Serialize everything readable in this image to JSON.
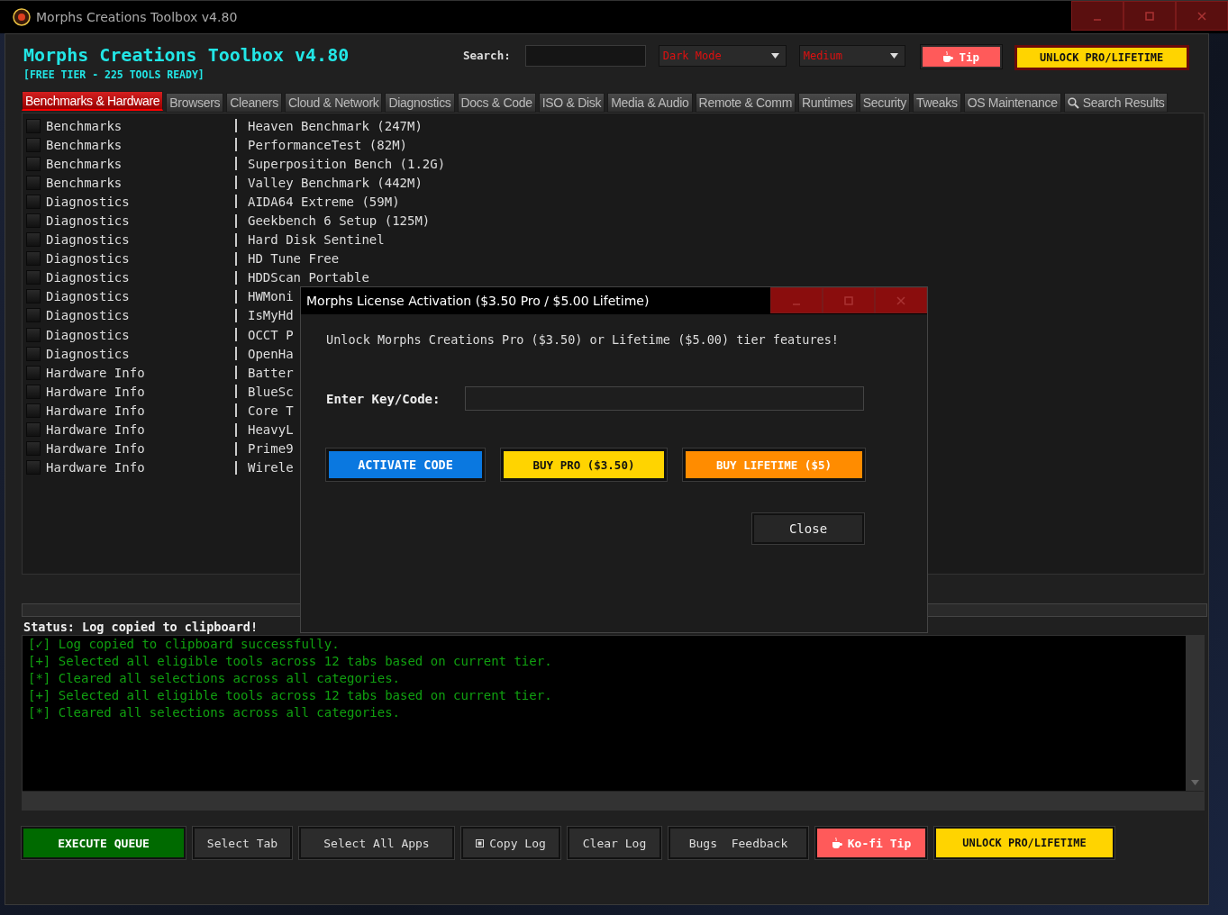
{
  "window": {
    "title": "Morphs Creations Toolbox v4.80"
  },
  "header": {
    "title": "Morphs Creations Toolbox v4.80",
    "subtitle": "[FREE TIER - 225 TOOLS READY]",
    "search_label": "Search:",
    "theme_select": "Dark Mode",
    "size_select": "Medium",
    "tip_button": "Tip",
    "unlock_button": "UNLOCK PRO/LIFETIME"
  },
  "tabs": [
    {
      "label": "Benchmarks & Hardware",
      "selected": true,
      "kind": "category"
    },
    {
      "label": "Browsers",
      "selected": false,
      "kind": "category"
    },
    {
      "label": "Cleaners",
      "selected": false,
      "kind": "category"
    },
    {
      "label": "Cloud & Network",
      "selected": false,
      "kind": "category"
    },
    {
      "label": "Diagnostics",
      "selected": false,
      "kind": "category"
    },
    {
      "label": "Docs & Code",
      "selected": false,
      "kind": "category"
    },
    {
      "label": "ISO & Disk",
      "selected": false,
      "kind": "category"
    },
    {
      "label": "Media & Audio",
      "selected": false,
      "kind": "category"
    },
    {
      "label": "Remote & Comm",
      "selected": false,
      "kind": "category"
    },
    {
      "label": "Runtimes",
      "selected": false,
      "kind": "category"
    },
    {
      "label": "Security",
      "selected": false,
      "kind": "category"
    },
    {
      "label": "Tweaks",
      "selected": false,
      "kind": "category"
    },
    {
      "label": "OS Maintenance",
      "selected": false,
      "kind": "category"
    },
    {
      "label": "Search Results",
      "selected": false,
      "kind": "search"
    }
  ],
  "tools": [
    {
      "category": "Benchmarks",
      "name": "Heaven Benchmark (247M)",
      "checked": false
    },
    {
      "category": "Benchmarks",
      "name": "PerformanceTest (82M)",
      "checked": false
    },
    {
      "category": "Benchmarks",
      "name": "Superposition Bench (1.2G)",
      "checked": false
    },
    {
      "category": "Benchmarks",
      "name": "Valley Benchmark (442M)",
      "checked": false
    },
    {
      "category": "Diagnostics",
      "name": "AIDA64 Extreme (59M)",
      "checked": false
    },
    {
      "category": "Diagnostics",
      "name": "Geekbench 6 Setup (125M)",
      "checked": false
    },
    {
      "category": "Diagnostics",
      "name": "Hard Disk Sentinel",
      "checked": false
    },
    {
      "category": "Diagnostics",
      "name": "HD Tune Free",
      "checked": false
    },
    {
      "category": "Diagnostics",
      "name": "HDDScan Portable",
      "checked": false
    },
    {
      "category": "Diagnostics",
      "name": "HWMoni",
      "checked": false
    },
    {
      "category": "Diagnostics",
      "name": "IsMyHd",
      "checked": false
    },
    {
      "category": "Diagnostics",
      "name": "OCCT P",
      "checked": false
    },
    {
      "category": "Diagnostics",
      "name": "OpenHa",
      "checked": false
    },
    {
      "category": "Hardware Info",
      "name": "Batter",
      "checked": false
    },
    {
      "category": "Hardware Info",
      "name": "BlueSc",
      "checked": false
    },
    {
      "category": "Hardware Info",
      "name": "Core T",
      "checked": false
    },
    {
      "category": "Hardware Info",
      "name": "HeavyL",
      "checked": false
    },
    {
      "category": "Hardware Info",
      "name": "Prime9",
      "checked": false
    },
    {
      "category": "Hardware Info",
      "name": "Wirele",
      "checked": false
    }
  ],
  "status": "Status: Log copied to clipboard!",
  "log": [
    "[✓] Log copied to clipboard successfully.",
    "[+] Selected all eligible tools across 12 tabs based on current tier.",
    "[*] Cleared all selections across all categories.",
    "[+] Selected all eligible tools across 12 tabs based on current tier.",
    "[*] Cleared all selections across all categories."
  ],
  "buttons": [
    {
      "label": "EXECUTE QUEUE",
      "kind": "execute"
    },
    {
      "label": "Select Tab",
      "kind": "plain"
    },
    {
      "label": "Select All Apps",
      "kind": "plain"
    },
    {
      "label": "Copy Log",
      "kind": "copy"
    },
    {
      "label": "Clear Log",
      "kind": "plain"
    },
    {
      "label": "Bugs  Feedback",
      "kind": "plain"
    },
    {
      "label": "Ko-fi Tip",
      "kind": "tip"
    },
    {
      "label": "UNLOCK PRO/LIFETIME",
      "kind": "unlock"
    }
  ],
  "dialog": {
    "title": "Morphs License Activation ($3.50 Pro / $5.00 Lifetime)",
    "message": "Unlock Morphs Creations Pro ($3.50) or Lifetime ($5.00) tier features!",
    "key_label": "Enter Key/Code:",
    "buttons": [
      {
        "label": "ACTIVATE CODE",
        "kind": "activate"
      },
      {
        "label": "BUY PRO ($3.50)",
        "kind": "pro"
      },
      {
        "label": "BUY LIFETIME ($5)",
        "kind": "lifetime"
      }
    ],
    "close_button": "Close"
  }
}
